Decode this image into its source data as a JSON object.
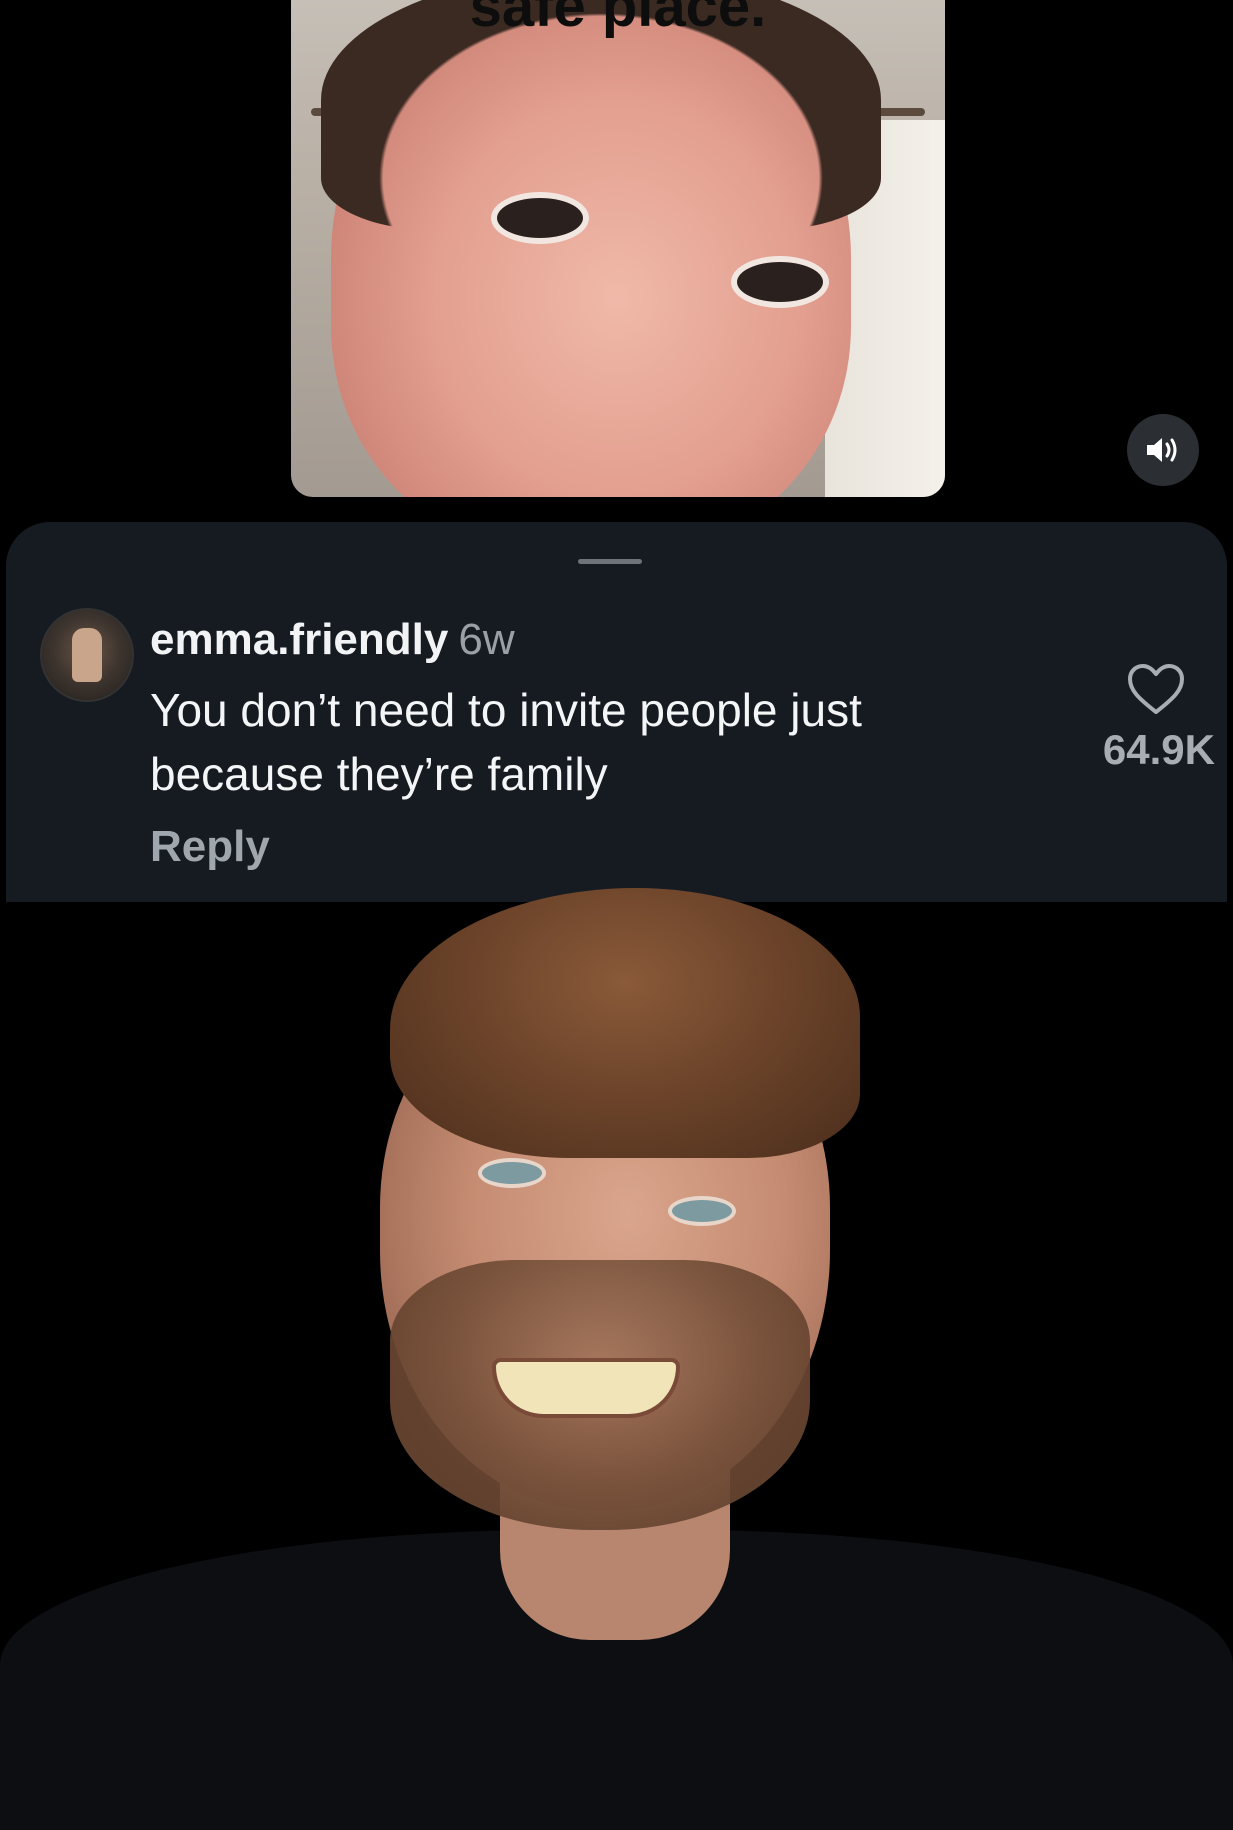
{
  "video": {
    "caption_fragment": "safe place."
  },
  "comment": {
    "username": "emma.friendly",
    "timestamp": "6w",
    "text": "You don’t need to invite people just because they’re family",
    "reply_label": "Reply",
    "like_count": "64.9K"
  },
  "icons": {
    "volume": "volume-icon",
    "like": "heart-icon"
  },
  "colors": {
    "sheet_background": "#161b21",
    "page_background": "#000000",
    "muted_text": "#9aa0a6"
  }
}
